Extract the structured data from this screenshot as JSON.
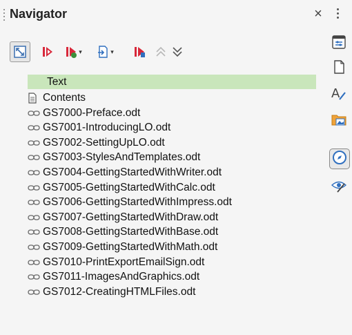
{
  "header": {
    "title": "Navigator",
    "close_icon": "×"
  },
  "toolbar": {
    "buttons": [
      {
        "name": "toggle-content-icon"
      },
      {
        "name": "previous-object-icon"
      },
      {
        "name": "next-object-icon"
      },
      {
        "name": "insert-icon"
      },
      {
        "name": "set-reminder-icon"
      },
      {
        "name": "promote-icon"
      },
      {
        "name": "demote-icon"
      }
    ]
  },
  "tree": {
    "header_label": "Text",
    "items": [
      {
        "label": "Contents",
        "icon": "document-icon"
      },
      {
        "label": "GS7000-Preface.odt",
        "icon": "link-icon"
      },
      {
        "label": "GS7001-IntroducingLO.odt",
        "icon": "link-icon"
      },
      {
        "label": "GS7002-SettingUpLO.odt",
        "icon": "link-icon"
      },
      {
        "label": "GS7003-StylesAndTemplates.odt",
        "icon": "link-icon"
      },
      {
        "label": "GS7004-GettingStartedWithWriter.odt",
        "icon": "link-icon"
      },
      {
        "label": "GS7005-GettingStartedWithCalc.odt",
        "icon": "link-icon"
      },
      {
        "label": "GS7006-GettingStartedWithImpress.odt",
        "icon": "link-icon"
      },
      {
        "label": "GS7007-GettingStartedWithDraw.odt",
        "icon": "link-icon"
      },
      {
        "label": "GS7008-GettingStartedWithBase.odt",
        "icon": "link-icon"
      },
      {
        "label": "GS7009-GettingStartedWithMath.odt",
        "icon": "link-icon"
      },
      {
        "label": "GS7010-PrintExportEmailSign.odt",
        "icon": "link-icon"
      },
      {
        "label": "GS7011-ImagesAndGraphics.odt",
        "icon": "link-icon"
      },
      {
        "label": "GS7012-CreatingHTMLFiles.odt",
        "icon": "link-icon"
      }
    ]
  },
  "sidebar": {
    "items": [
      {
        "name": "properties-icon"
      },
      {
        "name": "page-icon"
      },
      {
        "name": "styles-icon"
      },
      {
        "name": "gallery-icon"
      },
      {
        "name": "navigator-icon",
        "active": true
      },
      {
        "name": "style-inspector-icon"
      }
    ]
  },
  "colors": {
    "selection": "#c9e6bb",
    "accent_red": "#d8283a",
    "accent_blue": "#2f6fbf"
  }
}
